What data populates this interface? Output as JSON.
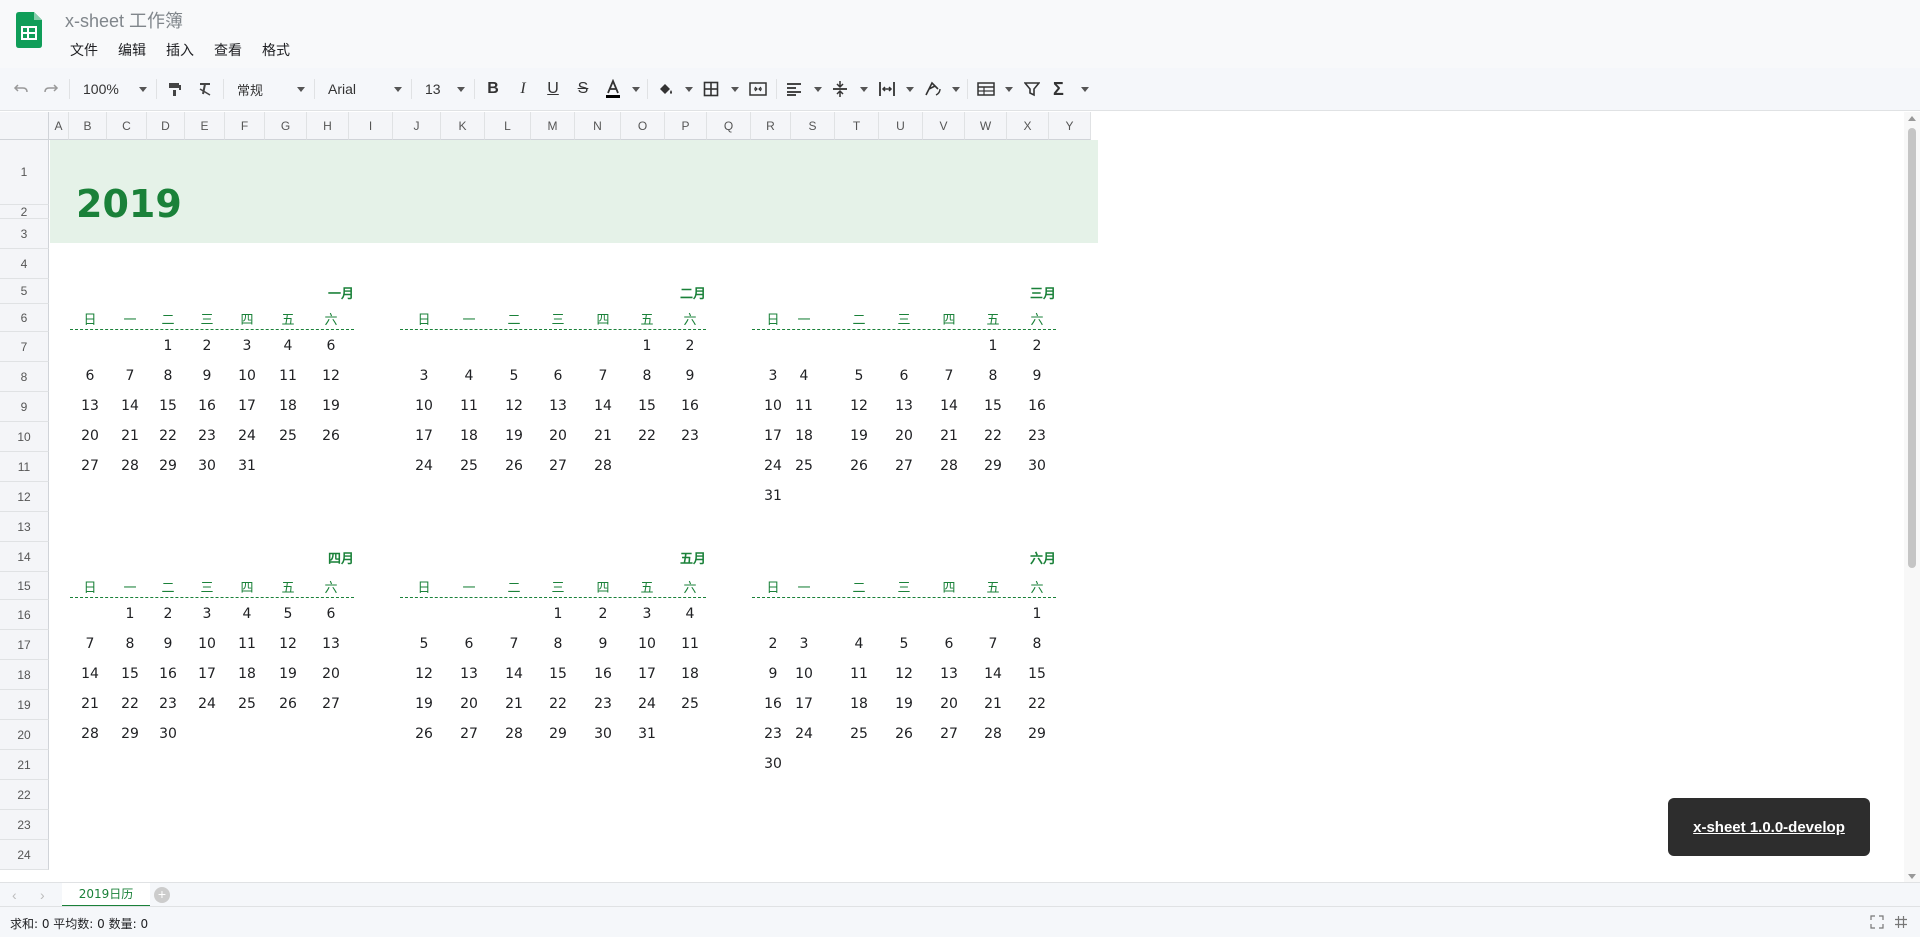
{
  "app": {
    "title": "x-sheet 工作簿",
    "brand_color": "#0F9D58",
    "accent_color": "#1A8139"
  },
  "menu": [
    "文件",
    "编辑",
    "插入",
    "查看",
    "格式"
  ],
  "toolbar": {
    "undo_icon": "undo-icon",
    "redo_icon": "redo-icon",
    "zoom": "100%",
    "format": "常规",
    "font_family": "Arial",
    "font_size": "13",
    "icons": [
      "paint-format-icon",
      "clear-format-icon",
      "bold-icon",
      "italic-icon",
      "underline-icon",
      "strikethrough-icon",
      "text-color-icon",
      "fill-color-icon",
      "borders-icon",
      "merge-cells-icon",
      "align-horizontal-icon",
      "align-vertical-icon",
      "text-wrap-icon",
      "text-rotate-icon",
      "table-format-icon",
      "filter-icon",
      "function-icon"
    ]
  },
  "columns": [
    "A",
    "B",
    "C",
    "D",
    "E",
    "F",
    "G",
    "H",
    "I",
    "J",
    "K",
    "L",
    "M",
    "N",
    "O",
    "P",
    "Q",
    "R",
    "S",
    "T",
    "U",
    "V",
    "W",
    "X",
    "Y"
  ],
  "rows": [
    "1",
    "2",
    "3",
    "4",
    "5",
    "6",
    "7",
    "8",
    "9",
    "10",
    "11",
    "12",
    "13",
    "14",
    "15",
    "16",
    "17",
    "18",
    "19",
    "20",
    "21",
    "22",
    "23",
    "24"
  ],
  "calendar": {
    "year": "2019",
    "weekdays": [
      "日",
      "一",
      "二",
      "三",
      "四",
      "五",
      "六"
    ],
    "months": [
      {
        "name": "一月",
        "weeks": [
          [
            "",
            "",
            "1",
            "2",
            "3",
            "4",
            "6"
          ],
          [
            "6",
            "7",
            "8",
            "9",
            "10",
            "11",
            "12"
          ],
          [
            "13",
            "14",
            "15",
            "16",
            "17",
            "18",
            "19"
          ],
          [
            "20",
            "21",
            "22",
            "23",
            "24",
            "25",
            "26"
          ],
          [
            "27",
            "28",
            "29",
            "30",
            "31",
            "",
            ""
          ]
        ]
      },
      {
        "name": "二月",
        "weeks": [
          [
            "",
            "",
            "",
            "",
            "",
            "1",
            "2"
          ],
          [
            "3",
            "4",
            "5",
            "6",
            "7",
            "8",
            "9"
          ],
          [
            "10",
            "11",
            "12",
            "13",
            "14",
            "15",
            "16"
          ],
          [
            "17",
            "18",
            "19",
            "20",
            "21",
            "22",
            "23"
          ],
          [
            "24",
            "25",
            "26",
            "27",
            "28",
            "",
            ""
          ]
        ]
      },
      {
        "name": "三月",
        "weeks": [
          [
            "",
            "",
            "",
            "",
            "",
            "1",
            "2"
          ],
          [
            "3",
            "4",
            "5",
            "6",
            "7",
            "8",
            "9"
          ],
          [
            "10",
            "11",
            "12",
            "13",
            "14",
            "15",
            "16"
          ],
          [
            "17",
            "18",
            "19",
            "20",
            "21",
            "22",
            "23"
          ],
          [
            "24",
            "25",
            "26",
            "27",
            "28",
            "29",
            "30"
          ],
          [
            "31",
            "",
            "",
            "",
            "",
            "",
            ""
          ]
        ]
      },
      {
        "name": "四月",
        "weeks": [
          [
            "",
            "1",
            "2",
            "3",
            "4",
            "5",
            "6"
          ],
          [
            "7",
            "8",
            "9",
            "10",
            "11",
            "12",
            "13"
          ],
          [
            "14",
            "15",
            "16",
            "17",
            "18",
            "19",
            "20"
          ],
          [
            "21",
            "22",
            "23",
            "24",
            "25",
            "26",
            "27"
          ],
          [
            "28",
            "29",
            "30",
            "",
            "",
            "",
            ""
          ]
        ]
      },
      {
        "name": "五月",
        "weeks": [
          [
            "",
            "",
            "",
            "1",
            "2",
            "3",
            "4"
          ],
          [
            "5",
            "6",
            "7",
            "8",
            "9",
            "10",
            "11"
          ],
          [
            "12",
            "13",
            "14",
            "15",
            "16",
            "17",
            "18"
          ],
          [
            "19",
            "20",
            "21",
            "22",
            "23",
            "24",
            "25"
          ],
          [
            "26",
            "27",
            "28",
            "29",
            "30",
            "31",
            ""
          ]
        ]
      },
      {
        "name": "六月",
        "weeks": [
          [
            "",
            "",
            "",
            "",
            "",
            "",
            "1"
          ],
          [
            "2",
            "3",
            "4",
            "5",
            "6",
            "7",
            "8"
          ],
          [
            "9",
            "10",
            "11",
            "12",
            "13",
            "14",
            "15"
          ],
          [
            "16",
            "17",
            "18",
            "19",
            "20",
            "21",
            "22"
          ],
          [
            "23",
            "24",
            "25",
            "26",
            "27",
            "28",
            "29"
          ],
          [
            "30",
            "",
            "",
            "",
            "",
            "",
            ""
          ]
        ]
      }
    ]
  },
  "sheets": {
    "active": "2019日历",
    "add_label": "+"
  },
  "status": {
    "text": "求和: 0  平均数: 0  数量: 0"
  },
  "toast": {
    "text": "x-sheet 1.0.0-develop"
  }
}
